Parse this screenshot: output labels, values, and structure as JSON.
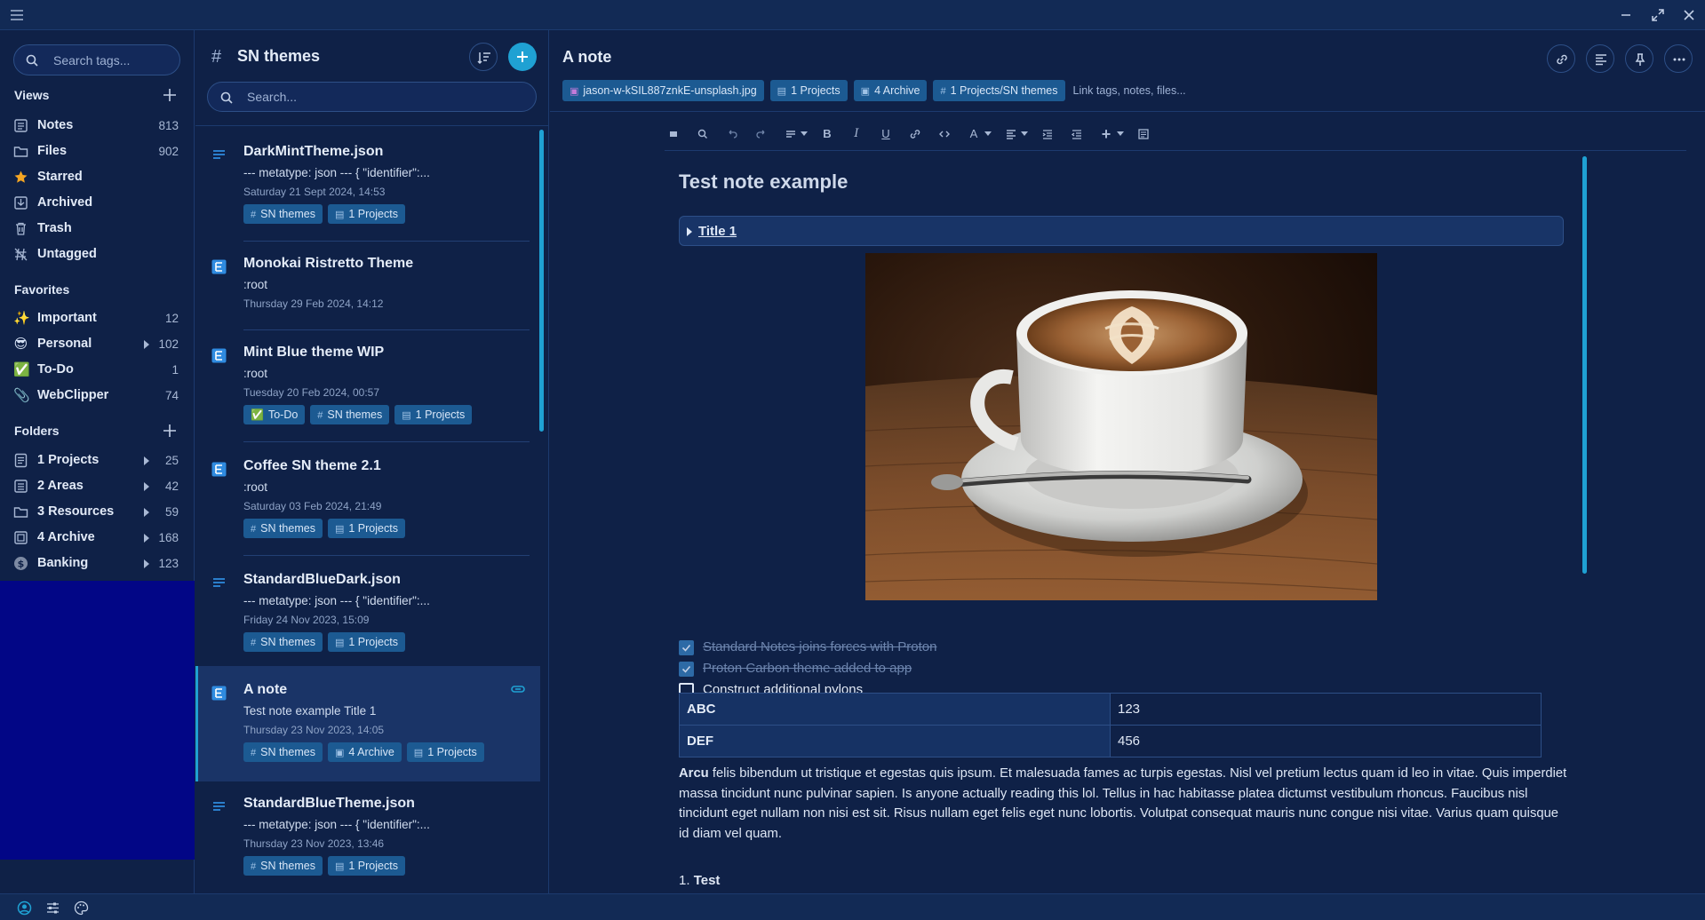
{
  "sidebar": {
    "search_placeholder": "Search tags...",
    "views_label": "Views",
    "views": [
      {
        "label": "Notes",
        "count": "813",
        "icon": "notes-icon"
      },
      {
        "label": "Files",
        "count": "902",
        "icon": "folder-icon"
      },
      {
        "label": "Starred",
        "count": "",
        "icon": "star-icon"
      },
      {
        "label": "Archived",
        "count": "",
        "icon": "archive-icon"
      },
      {
        "label": "Trash",
        "count": "",
        "icon": "trash-icon"
      },
      {
        "label": "Untagged",
        "count": "",
        "icon": "untagged-icon"
      }
    ],
    "favorites_label": "Favorites",
    "favorites": [
      {
        "label": "Important",
        "count": "12",
        "emoji": "✨"
      },
      {
        "label": "Personal",
        "count": "102",
        "emoji": "😎"
      },
      {
        "label": "To-Do",
        "count": "1",
        "emoji": "✅"
      },
      {
        "label": "WebClipper",
        "count": "74",
        "emoji": "📎"
      }
    ],
    "folders_label": "Folders",
    "folders": [
      {
        "label": "1 Projects",
        "count": "25"
      },
      {
        "label": "2 Areas",
        "count": "42"
      },
      {
        "label": "3 Resources",
        "count": "59"
      },
      {
        "label": "4 Archive",
        "count": "168"
      },
      {
        "label": "Banking",
        "count": "123"
      }
    ]
  },
  "notes": {
    "header_title": "SN themes",
    "search_placeholder": "Search...",
    "items": [
      {
        "title": "DarkMintTheme.json",
        "preview": "--- metatype: json --- { \"identifier\":...",
        "date": "Saturday 21 Sept 2024, 14:53",
        "tags": [
          "SN themes",
          "1 Projects"
        ]
      },
      {
        "title": "Monokai Ristretto Theme",
        "preview": ":root",
        "date": "Thursday 29 Feb 2024, 14:12",
        "tags": []
      },
      {
        "title": "Mint Blue theme WIP",
        "preview": ":root",
        "date": "Tuesday 20 Feb 2024, 00:57",
        "tags": [
          "To-Do",
          "SN themes",
          "1 Projects"
        ]
      },
      {
        "title": "Coffee SN theme 2.1",
        "preview": ":root",
        "date": "Saturday 03 Feb 2024, 21:49",
        "tags": [
          "SN themes",
          "1 Projects"
        ]
      },
      {
        "title": "StandardBlueDark.json",
        "preview": "--- metatype: json --- { \"identifier\":...",
        "date": "Friday 24 Nov 2023, 15:09",
        "tags": [
          "SN themes",
          "1 Projects"
        ]
      },
      {
        "title": "A note",
        "preview": "Test note example Title 1",
        "date": "Thursday 23 Nov 2023, 14:05",
        "tags": [
          "SN themes",
          "4 Archive",
          "1 Projects"
        ]
      },
      {
        "title": "StandardBlueTheme.json",
        "preview": "--- metatype: json --- { \"identifier\":...",
        "date": "Thursday 23 Nov 2023, 13:46",
        "tags": [
          "SN themes",
          "1 Projects"
        ]
      }
    ]
  },
  "editor": {
    "title": "A note",
    "chips": [
      "jason-w-kSIL887znkE-unsplash.jpg",
      "1 Projects",
      "4 Archive",
      "1 Projects/SN themes"
    ],
    "link_placeholder": "Link tags, notes, files...",
    "doc_title": "Test note example",
    "collapsible_title": "Title 1",
    "checklist": [
      {
        "text": "Standard Notes joins forces with Proton",
        "done": true
      },
      {
        "text": "Proton Carbon theme added to app",
        "done": true
      },
      {
        "text": "Construct additional pylons",
        "done": false
      }
    ],
    "table": [
      [
        "ABC",
        "123"
      ],
      [
        "DEF",
        "456"
      ]
    ],
    "paragraph_bold": "Arcu",
    "paragraph_rest": " felis bibendum ut tristique et egestas quis ipsum. Et malesuada fames ac turpis egestas. Nisl vel pretium lectus quam id leo in vitae. Quis imperdiet massa tincidunt nunc pulvinar sapien. Is anyone actually reading this lol. Tellus in hac habitasse platea dictumst vestibulum rhoncus. Faucibus nisl tincidunt eget nullam non nisi est sit. Risus nullam eget felis eget nunc lobortis. Volutpat consequat mauris nunc congue nisi vitae. Varius quam quisque id diam vel quam.",
    "list_number": "1.",
    "list_item": "Test"
  },
  "colors": {
    "background": "#0f2147",
    "accent": "#1fa1d3",
    "tag": "#1c5a92",
    "highlight_panel": "#020686"
  }
}
